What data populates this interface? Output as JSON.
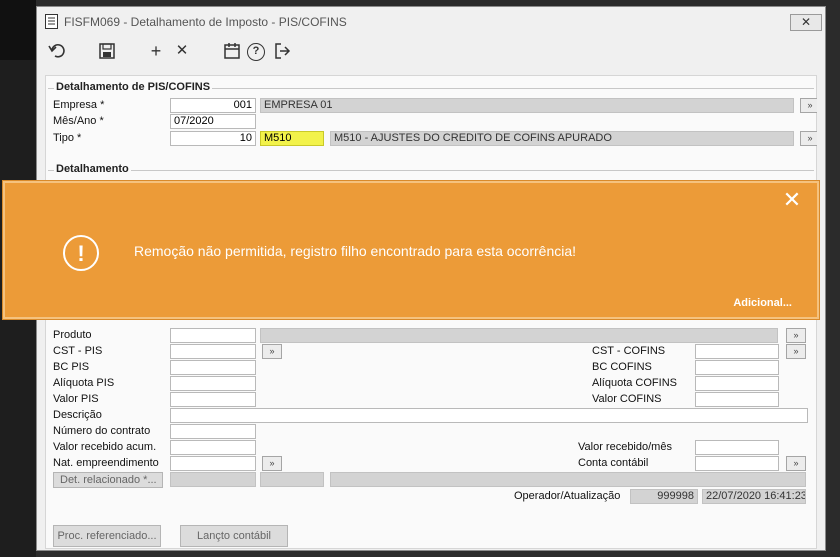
{
  "window": {
    "title": "FISFM069 - Detalhamento de Imposto - PIS/COFINS",
    "close_glyph": "✕"
  },
  "toolbar": {
    "undo": "undo-icon",
    "save": "save-icon",
    "add": "+",
    "delete": "✕",
    "calendar": "calendar-icon",
    "help": "?",
    "exit": "exit-icon"
  },
  "header_group": {
    "title": "Detalhamento de PIS/COFINS",
    "empresa_label": "Empresa *",
    "empresa_code": "001",
    "empresa_name": "EMPRESA 01",
    "mes_label": "Mês/Ano *",
    "mes_value": "07/2020",
    "tipo_label": "Tipo *",
    "tipo_num": "10",
    "tipo_code": "M510",
    "tipo_desc": "M510 - AJUSTES DO CREDITO DE COFINS APURADO"
  },
  "detail_group": {
    "title": "Detalhamento",
    "produto": "Produto",
    "cst_pis": "CST - PIS",
    "bc_pis": "BC PIS",
    "aliquota_pis": "Alíquota PIS",
    "valor_pis": "Valor PIS",
    "descricao": "Descrição",
    "numero_contrato": "Número do contrato",
    "valor_recebido_acum": "Valor recebido acum.",
    "nat_empreendimento": "Nat. empreendimento",
    "det_relacionado": "Det. relacionado *...",
    "cst_cofins": "CST - COFINS",
    "bc_cofins": "BC COFINS",
    "aliquota_cofins": "Alíquota COFINS",
    "valor_cofins": "Valor COFINS",
    "valor_recebido_mes": "Valor recebido/mês",
    "conta_contabil": "Conta contábil",
    "operador_label": "Operador/Atualização",
    "operador_value": "999998",
    "atualizacao_value": "22/07/2020 16:41:23"
  },
  "footer": {
    "proc_referenciado": "Proc. referenciado...",
    "lancto_contabil": "Lançto contábil"
  },
  "toast": {
    "message": "Remoção não permitida, registro filho encontrado para esta ocorrência!",
    "more": "Adicional...",
    "close_glyph": "✕",
    "icon_glyph": "!",
    "color": "#ec9b38"
  },
  "colors": {
    "highlight": "#f2f24a",
    "readonly": "#d3d3d3"
  }
}
